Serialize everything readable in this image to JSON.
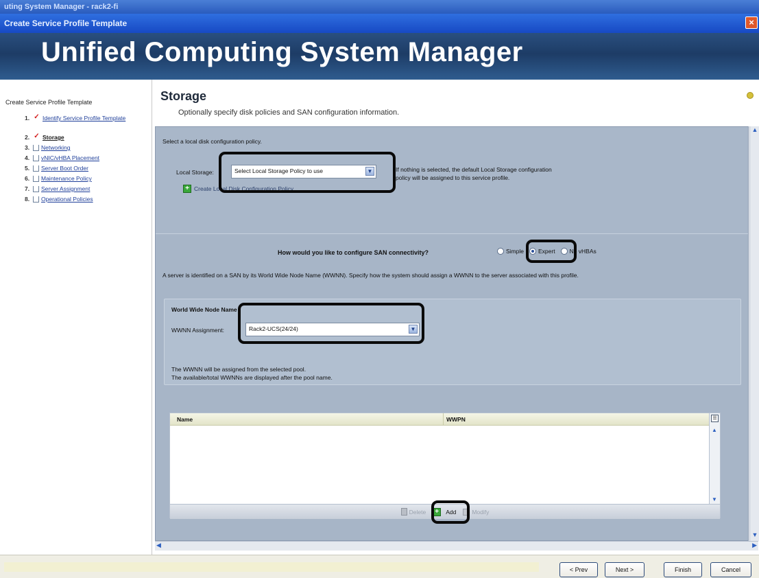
{
  "window": {
    "app_title": "uting System Manager - rack2-fi",
    "dialog_title": "Create Service Profile Template"
  },
  "banner": {
    "title": "Unified Computing System Manager"
  },
  "sidebar": {
    "title": "Create Service Profile Template",
    "steps": [
      {
        "num": "1.",
        "label": "Identify Service Profile Template",
        "status": "done"
      },
      {
        "num": "2.",
        "label": "Storage",
        "status": "current"
      },
      {
        "num": "3.",
        "label": "Networking",
        "status": "pending"
      },
      {
        "num": "4.",
        "label": "vNIC/vHBA Placement",
        "status": "pending"
      },
      {
        "num": "5.",
        "label": "Server Boot Order",
        "status": "pending"
      },
      {
        "num": "6.",
        "label": "Maintenance Policy",
        "status": "pending"
      },
      {
        "num": "7.",
        "label": "Server Assignment",
        "status": "pending"
      },
      {
        "num": "8.",
        "label": "Operational Policies",
        "status": "pending"
      }
    ]
  },
  "main": {
    "title": "Storage",
    "subtitle": "Optionally specify disk policies and SAN configuration information.",
    "local": {
      "prompt": "Select a local disk configuration policy.",
      "label": "Local Storage:",
      "selected": "Select Local Storage Policy to use",
      "note_line1": "If nothing is selected, the default Local Storage configuration",
      "note_line2": "policy will be assigned to this service profile.",
      "create_label": "Create Local Disk Configuration Policy"
    },
    "san": {
      "question": "How would you like to configure SAN connectivity?",
      "options": [
        "Simple",
        "Expert",
        "No vHBAs"
      ],
      "selected": "Expert"
    },
    "wwnn": {
      "description": "A server is identified on a SAN by its World Wide Node Name (WWNN). Specify how the system should assign a WWNN to the server associated with this profile.",
      "panel_title": "World Wide Node Name",
      "assignment_label": "WWNN Assignment:",
      "assignment_value": "Rack2-UCS(24/24)",
      "note_line1": "The WWNN will be assigned from the selected pool.",
      "note_line2": "The available/total WWNNs are displayed after the pool name."
    },
    "table": {
      "columns": [
        "Name",
        "WWPN"
      ],
      "rows": [],
      "delete_label": "Delete",
      "add_label": "Add",
      "modify_label": "Modify"
    }
  },
  "footer": {
    "prev_label": "< Prev",
    "next_label": "Next >",
    "finish_label": "Finish",
    "cancel_label": "Cancel"
  },
  "colors": {
    "banner": "#1d3c66",
    "panel": "#a9b7c9",
    "link": "#1f3f9a",
    "check": "#d21c1c",
    "add_green": "#3aa83a"
  }
}
